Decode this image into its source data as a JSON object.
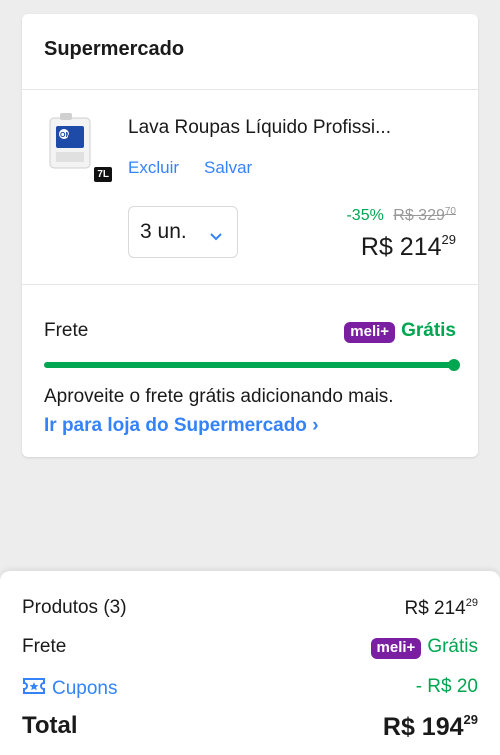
{
  "store": {
    "title": "Supermercado"
  },
  "item": {
    "title": "Lava Roupas Líquido Profissi...",
    "image_alt": "OMO",
    "size_badge": "7L",
    "delete_label": "Excluir",
    "save_label": "Salvar",
    "quantity": "3 un.",
    "discount": "-35%",
    "old_price_int": "R$ 329",
    "old_price_cents": "70",
    "price_int": "R$ 214",
    "price_cents": "29"
  },
  "shipping": {
    "label": "Frete",
    "meli_badge": "meli+",
    "value": "Grátis",
    "progress": 1.0,
    "promo_text": "Aproveite o frete grátis adicionando mais.",
    "store_link": "Ir para loja do Supermercado",
    "store_link_chevron": "›"
  },
  "summary": {
    "products_label": "Produtos (3)",
    "products_int": "R$ 214",
    "products_cents": "29",
    "shipping_label": "Frete",
    "shipping_badge": "meli+",
    "shipping_value": "Grátis",
    "coupons_label": "Cupons",
    "coupons_value": "- R$ 20",
    "total_label": "Total",
    "total_int": "R$ 194",
    "total_cents": "29"
  },
  "colors": {
    "green": "#00a650",
    "blue": "#3483fa",
    "meli_purple": "#7b1fa2"
  },
  "icons": {
    "quantity_chevron": "chevron-down-icon",
    "coupon": "ticket-icon"
  }
}
